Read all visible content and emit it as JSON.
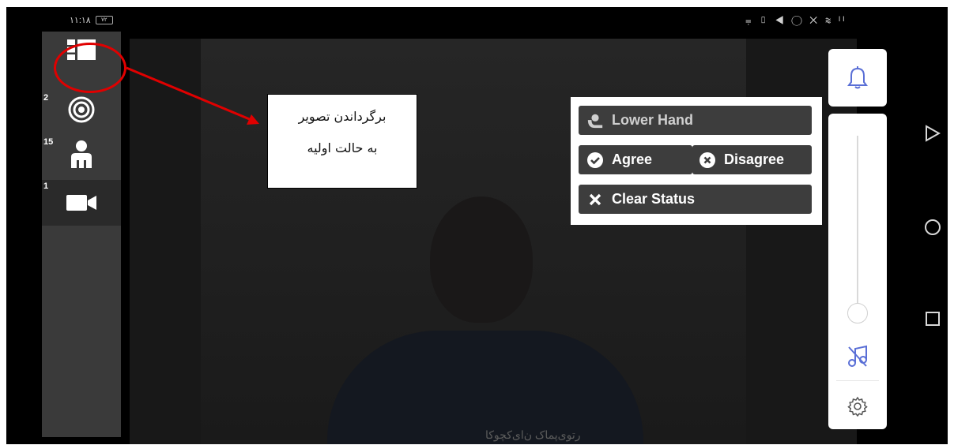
{
  "status_bar": {
    "time": "۱۱:۱۸",
    "battery": "۷۲",
    "icons": "⩦ ▯ ◀ ◯ ✕ ≋ ᴵᴵ"
  },
  "sidebar": {
    "items": [
      {
        "count": "",
        "icon": "layout-toggle-icon"
      },
      {
        "count": "2",
        "icon": "target-icon"
      },
      {
        "count": "15",
        "icon": "person-icon"
      },
      {
        "count": "1",
        "icon": "video-camera-icon"
      }
    ]
  },
  "annotation": {
    "line1": "برگرداندن تصویر",
    "line2": "به حالت اولیه",
    "color": "#e00000"
  },
  "status_menu": {
    "lower_hand": "Lower Hand",
    "agree": "Agree",
    "disagree": "Disagree",
    "clear_status": "Clear Status"
  },
  "video": {
    "caption": "رتوی‌پماک ن‌ای‌کچوکا"
  },
  "right_panel": {
    "icons": [
      "bell-icon",
      "music-off-icon",
      "gear-icon"
    ],
    "accent": "#5a6fd6"
  },
  "nav": {
    "icons": [
      "back-triangle-icon",
      "home-circle-icon",
      "recents-square-icon"
    ]
  }
}
